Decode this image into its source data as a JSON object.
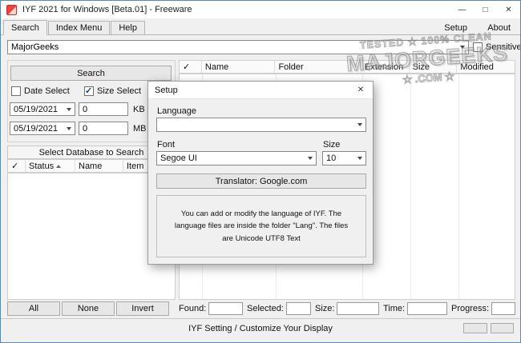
{
  "window": {
    "title": "IYF 2021 for Windows [Beta.01] - Freeware",
    "controls": {
      "minimize": "—",
      "maximize": "□",
      "close": "✕"
    }
  },
  "tabs": {
    "search": "Search",
    "index_menu": "Index Menu",
    "help": "Help",
    "setup": "Setup",
    "about": "About"
  },
  "search_bar": {
    "value": "MajorGeeks",
    "sensitive_label": "Sensitive"
  },
  "left_panel": {
    "search_button": "Search",
    "date_select_label": "Date Select",
    "size_select_label": "Size Select",
    "date_from": "05/19/2021",
    "date_to": "05/19/2021",
    "size_from": "0",
    "size_to": "0",
    "kb_label": "KB",
    "mb_label": "MB",
    "db_header": "Select Database to Search",
    "db_columns": {
      "check": "✓",
      "status": "Status",
      "name": "Name",
      "item": "Item"
    },
    "all_button": "All",
    "none_button": "None",
    "invert_button": "Invert"
  },
  "results": {
    "columns": {
      "check": "✓",
      "name": "Name",
      "folder": "Folder",
      "extension": "Extension",
      "size": "Size",
      "modified": "Modified"
    },
    "found_label": "Found:",
    "selected_label": "Selected:",
    "size_label": "Size:",
    "time_label": "Time:",
    "progress_label": "Progress:"
  },
  "setup_dialog": {
    "title": "Setup",
    "close": "✕",
    "language_label": "Language",
    "language_value": "",
    "font_label": "Font",
    "font_value": "Segoe UI",
    "size_label": "Size",
    "size_value": "10",
    "translator_button": "Translator: Google.com",
    "info_text": "You can add or modify the language of IYF. The language files are inside the folder \"Lang\". The files are Unicode UTF8 Text"
  },
  "status_bar": {
    "text": "IYF Setting / Customize Your Display"
  },
  "watermark": {
    "line1": "TESTED ★ 100% CLEAN",
    "line2": "MAJORGEEKS",
    "line3": "★ .COM ★"
  },
  "colors": {
    "window_border": "#5b87b5",
    "titlebar_bg": "#ffffff",
    "panel_bg": "#f0f0f0",
    "control_border": "#888888",
    "button_bg": "#e7e7e7",
    "watermark_gray": "#9a9a9a"
  }
}
